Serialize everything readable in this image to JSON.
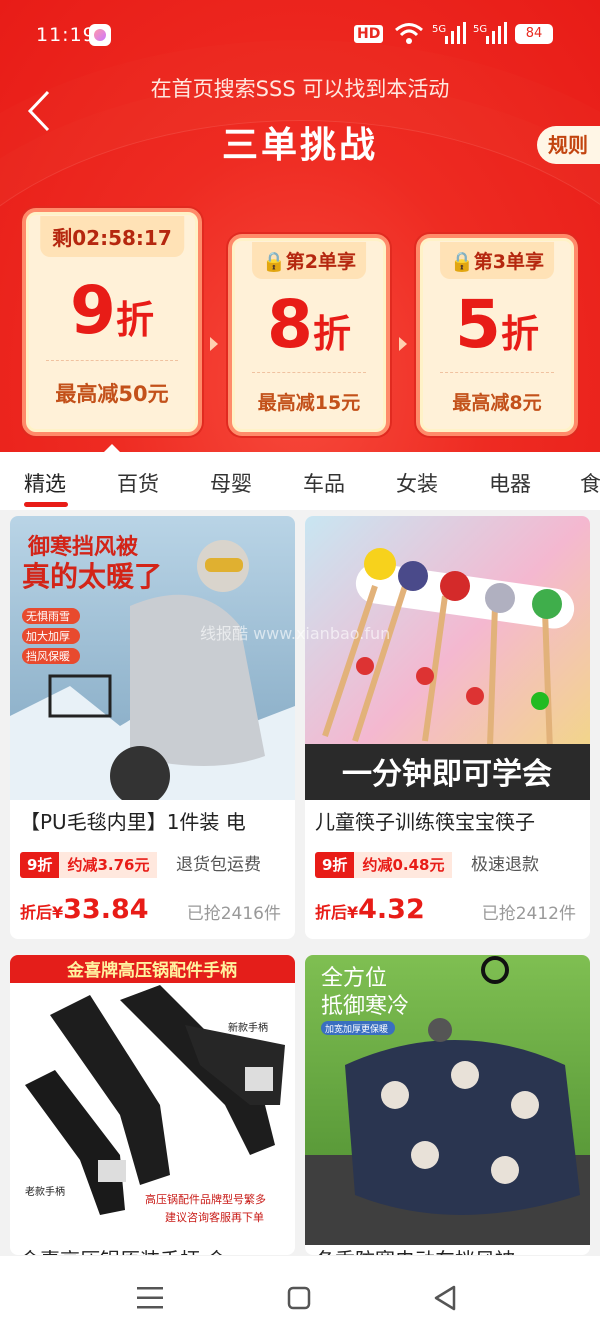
{
  "status": {
    "time": "11:19",
    "hd": "HD",
    "hd_sub": "1 2",
    "net1": "5G",
    "net2": "5G",
    "battery": "84"
  },
  "header": {
    "subtitle": "在首页搜索SSS 可以找到本活动",
    "title": "三单挑战",
    "rules": "规则"
  },
  "cards": [
    {
      "top": "剩02:58:17",
      "num": "9",
      "unit": "折",
      "bottom": "最高减50元"
    },
    {
      "top": "第2单享",
      "num": "8",
      "unit": "折",
      "bottom": "最高减15元"
    },
    {
      "top": "第3单享",
      "num": "5",
      "unit": "折",
      "bottom": "最高减8元"
    }
  ],
  "tabs": [
    "精选",
    "百货",
    "母婴",
    "车品",
    "女装",
    "电器",
    "食"
  ],
  "watermark": "线报酷 www.xianbao.fun",
  "products": [
    {
      "banner": "御寒挡风被",
      "banner2": "真的太暖了",
      "chips": [
        "无惧雨雪",
        "加大加厚",
        "挡风保暖"
      ],
      "name": "【PU毛毯内里】1件装 电",
      "disc": "9折",
      "save": "约减3.76元",
      "tag": "退货包运费",
      "after_label": "折后¥",
      "price": "33.84",
      "sold": "已抢2416件"
    },
    {
      "banner": "一分钟即可学会",
      "name": "儿童筷子训练筷宝宝筷子",
      "disc": "9折",
      "save": "约减0.48元",
      "tag": "极速退款",
      "after_label": "折后¥",
      "price": "4.32",
      "sold": "已抢2412件"
    },
    {
      "banner": "金喜牌高压锅配件手柄",
      "lbl1": "新款手柄",
      "lbl2": "老款手柄",
      "note1": "高压锅配件品牌型号繁多",
      "note2": "建议咨询客服再下单",
      "name": "金喜高压锅原装手柄 金"
    },
    {
      "banner": "全方位",
      "banner2": "抵御寒冷",
      "chip": "加宽加厚更保暖",
      "name": "冬季防寒电动车挡风被"
    }
  ],
  "colors": {
    "red": "#e81c17",
    "cream": "#fff1d8"
  }
}
